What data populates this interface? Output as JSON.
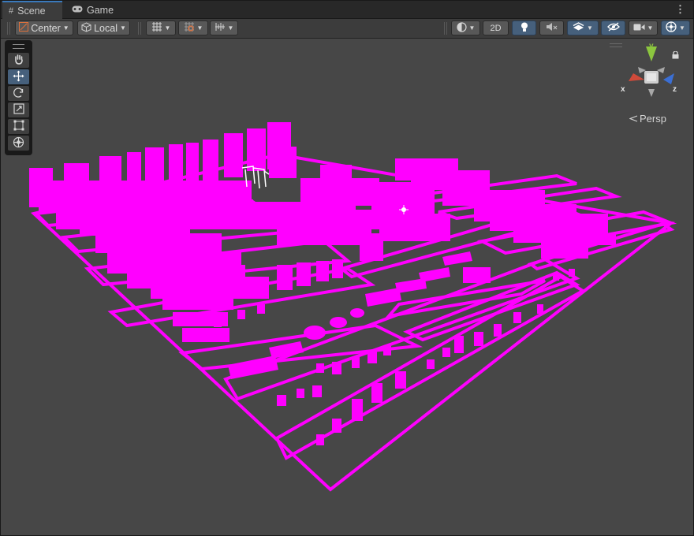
{
  "tabs": [
    {
      "label": "Scene",
      "icon": "grid-icon",
      "active": true
    },
    {
      "label": "Game",
      "icon": "gamepad-icon",
      "active": false
    }
  ],
  "toolbar": {
    "pivot_mode": "Center",
    "pivot_rotation": "Local",
    "mode_2d": "2D"
  },
  "gizmo": {
    "axis_x": "x",
    "axis_y": "y",
    "axis_z": "z",
    "projection": "Persp"
  },
  "colors": {
    "accent": "#3a79bb",
    "active_button": "#46607c",
    "viewport_bg": "#474747",
    "missing_material": "#ff00ff",
    "axis_x": "#d04a3a",
    "axis_y": "#8cc63f",
    "axis_z": "#3b6fd4"
  },
  "tools": [
    {
      "name": "hand-icon"
    },
    {
      "name": "move-icon",
      "active": true
    },
    {
      "name": "rotate-icon"
    },
    {
      "name": "scale-icon"
    },
    {
      "name": "rect-tool-icon"
    },
    {
      "name": "transform-icon"
    }
  ]
}
